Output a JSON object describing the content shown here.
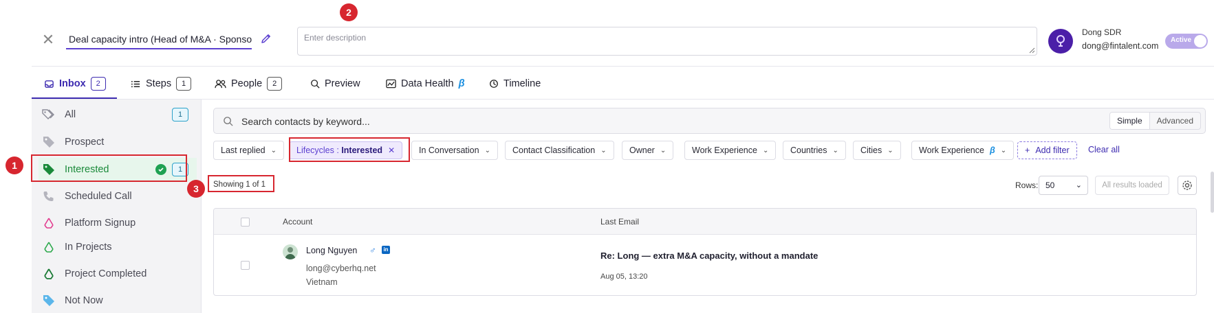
{
  "header": {
    "title": "Deal capacity intro (Head of M&A · Sponsor",
    "description_placeholder": "Enter description",
    "user_name": "Dong SDR",
    "user_email": "dong@fintalent.com",
    "toggle_label": "Active"
  },
  "tabs": [
    {
      "label": "Inbox",
      "count": "2"
    },
    {
      "label": "Steps",
      "count": "1"
    },
    {
      "label": "People",
      "count": "2"
    },
    {
      "label": "Preview"
    },
    {
      "label": "Data Health",
      "suffix": "β"
    },
    {
      "label": "Timeline"
    }
  ],
  "sidebar": {
    "items": [
      {
        "label": "All",
        "count": "1"
      },
      {
        "label": "Prospect"
      },
      {
        "label": "Interested",
        "count": "1"
      },
      {
        "label": "Scheduled Call"
      },
      {
        "label": "Platform Signup"
      },
      {
        "label": "In Projects"
      },
      {
        "label": "Project Completed"
      },
      {
        "label": "Not Now"
      }
    ]
  },
  "search": {
    "placeholder": "Search contacts by keyword...",
    "mode_simple": "Simple",
    "mode_advanced": "Advanced"
  },
  "filters": {
    "last_replied": "Last replied",
    "lifecycle_key": "Lifecycles : ",
    "lifecycle_value": "Interested",
    "in_conversation": "In Conversation",
    "contact_classification": "Contact Classification",
    "owner": "Owner",
    "work_experience": "Work Experience",
    "countries": "Countries",
    "cities": "Cities",
    "work_experience_beta": "Work Experience",
    "beta": "β",
    "add_filter": "Add filter",
    "clear_all": "Clear all"
  },
  "results": {
    "showing": "Showing 1 of 1",
    "rows_label": "Rows:",
    "rows_value": "50",
    "all_loaded": "All results loaded"
  },
  "table": {
    "col_account": "Account",
    "col_last_email": "Last Email",
    "rows": [
      {
        "name": "Long Nguyen",
        "email": "long@cyberhq.net",
        "country": "Vietnam",
        "subject": "Re: Long — extra M&A capacity, without a mandate",
        "date": "Aug 05, 13:20"
      }
    ]
  },
  "annotations": [
    "1",
    "2",
    "3"
  ],
  "colors": {
    "accent": "#3d2bb0",
    "active_green": "#1a8a3a",
    "annotation_red": "#d7262f"
  }
}
